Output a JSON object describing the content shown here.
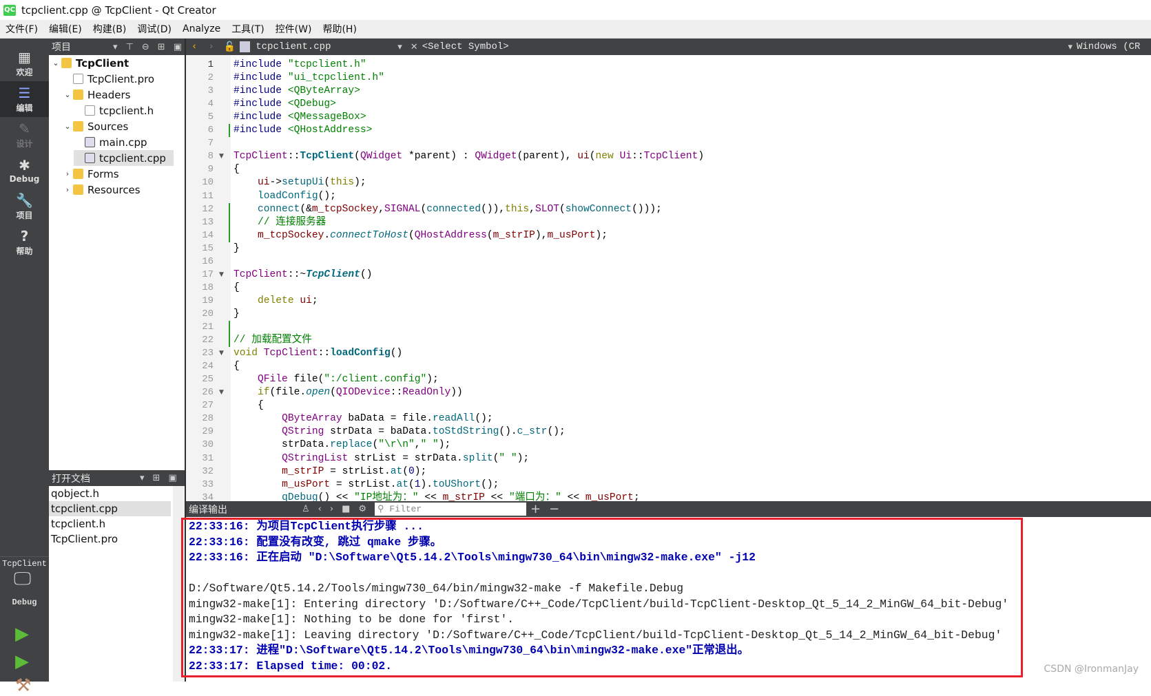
{
  "window": {
    "title": "tcpclient.cpp @ TcpClient - Qt Creator",
    "logo": "QC"
  },
  "menu": [
    "文件(F)",
    "编辑(E)",
    "构建(B)",
    "调试(D)",
    "Analyze",
    "工具(T)",
    "控件(W)",
    "帮助(H)"
  ],
  "modes": [
    {
      "label": "欢迎",
      "icon": "grid-icon"
    },
    {
      "label": "编辑",
      "icon": "edit-icon",
      "active": true
    },
    {
      "label": "设计",
      "icon": "pencil-icon",
      "disabled": true
    },
    {
      "label": "Debug",
      "icon": "bug-icon"
    },
    {
      "label": "项目",
      "icon": "wrench-icon"
    },
    {
      "label": "帮助",
      "icon": "help-icon"
    }
  ],
  "kit": {
    "project": "TcpClient",
    "config": "Debug"
  },
  "project_panel": {
    "title": "项目",
    "tree": [
      {
        "label": "TcpClient",
        "depth": 0,
        "chev": "down",
        "bold": true,
        "icon": "folder"
      },
      {
        "label": "TcpClient.pro",
        "depth": 1,
        "icon": "file"
      },
      {
        "label": "Headers",
        "depth": 1,
        "chev": "down",
        "icon": "folder"
      },
      {
        "label": "tcpclient.h",
        "depth": 2,
        "icon": "file"
      },
      {
        "label": "Sources",
        "depth": 1,
        "chev": "down",
        "icon": "folder"
      },
      {
        "label": "main.cpp",
        "depth": 2,
        "icon": "cppfile"
      },
      {
        "label": "tcpclient.cpp",
        "depth": 2,
        "icon": "cppfile",
        "selected": true
      },
      {
        "label": "Forms",
        "depth": 1,
        "chev": "right",
        "icon": "folder"
      },
      {
        "label": "Resources",
        "depth": 1,
        "chev": "right",
        "icon": "folder"
      }
    ]
  },
  "open_docs": {
    "title": "打开文档",
    "items": [
      "qobject.h",
      "tcpclient.cpp",
      "tcpclient.h",
      "TcpClient.pro"
    ],
    "selected": 1
  },
  "editor": {
    "file": "tcpclient.cpp",
    "symbol": "<Select Symbol>",
    "line_ending": "Windows (CR",
    "fold_lines": [
      8,
      17,
      23,
      26
    ],
    "changed_lines": [
      6,
      12,
      13,
      14,
      21,
      22
    ],
    "current_line": 1,
    "lines": [
      [
        [
          "#include",
          "pp"
        ],
        [
          " "
        ],
        [
          "\"tcpclient.h\"",
          "str"
        ]
      ],
      [
        [
          "#include",
          "pp"
        ],
        [
          " "
        ],
        [
          "\"ui_tcpclient.h\"",
          "str"
        ]
      ],
      [
        [
          "#include",
          "pp"
        ],
        [
          " "
        ],
        [
          "<QByteArray>",
          "str"
        ]
      ],
      [
        [
          "#include",
          "pp"
        ],
        [
          " "
        ],
        [
          "<QDebug>",
          "str"
        ]
      ],
      [
        [
          "#include",
          "pp"
        ],
        [
          " "
        ],
        [
          "<QMessageBox>",
          "str"
        ]
      ],
      [
        [
          "#include",
          "pp"
        ],
        [
          " "
        ],
        [
          "<QHostAddress>",
          "str"
        ]
      ],
      [],
      [
        [
          "TcpClient",
          "type"
        ],
        [
          "::"
        ],
        [
          "TcpClient",
          "fnb"
        ],
        [
          "("
        ],
        [
          "QWidget",
          "type"
        ],
        [
          " *parent) : "
        ],
        [
          "QWidget",
          "type"
        ],
        [
          "(parent), "
        ],
        [
          "ui",
          "mem"
        ],
        [
          "("
        ],
        [
          "new",
          "kw"
        ],
        [
          " "
        ],
        [
          "Ui",
          "type"
        ],
        [
          "::"
        ],
        [
          "TcpClient",
          "type"
        ],
        [
          ")"
        ]
      ],
      [
        [
          "{"
        ]
      ],
      [
        [
          "    "
        ],
        [
          "ui",
          "mem"
        ],
        [
          "->"
        ],
        [
          "setupUi",
          "fn"
        ],
        [
          "("
        ],
        [
          "this",
          "kw"
        ],
        [
          ");"
        ]
      ],
      [
        [
          "    "
        ],
        [
          "loadConfig",
          "fn"
        ],
        [
          "();"
        ]
      ],
      [
        [
          "    "
        ],
        [
          "connect",
          "fn"
        ],
        [
          "(&"
        ],
        [
          "m_tcpSockey",
          "mem"
        ],
        [
          ","
        ],
        [
          "SIGNAL",
          "type"
        ],
        [
          "("
        ],
        [
          "connected",
          "fn"
        ],
        [
          "()),"
        ],
        [
          "this",
          "kw"
        ],
        [
          ","
        ],
        [
          "SLOT",
          "type"
        ],
        [
          "("
        ],
        [
          "showConnect",
          "fn"
        ],
        [
          "()));"
        ]
      ],
      [
        [
          "    "
        ],
        [
          "// 连接服务器",
          "cm"
        ]
      ],
      [
        [
          "    "
        ],
        [
          "m_tcpSockey",
          "mem"
        ],
        [
          "."
        ],
        [
          "connectToHost",
          "it"
        ],
        [
          "("
        ],
        [
          "QHostAddress",
          "type"
        ],
        [
          "("
        ],
        [
          "m_strIP",
          "mem"
        ],
        [
          "),"
        ],
        [
          "m_usPort",
          "mem"
        ],
        [
          ");"
        ]
      ],
      [
        [
          "}"
        ]
      ],
      [],
      [
        [
          "TcpClient",
          "type"
        ],
        [
          "::~"
        ],
        [
          "TcpClient",
          "fnbi"
        ],
        [
          "()"
        ]
      ],
      [
        [
          "{"
        ]
      ],
      [
        [
          "    "
        ],
        [
          "delete",
          "kw"
        ],
        [
          " "
        ],
        [
          "ui",
          "mem"
        ],
        [
          ";"
        ]
      ],
      [
        [
          "}"
        ]
      ],
      [],
      [
        [
          "// 加载配置文件",
          "cm"
        ]
      ],
      [
        [
          "void",
          "kw"
        ],
        [
          " "
        ],
        [
          "TcpClient",
          "type"
        ],
        [
          "::"
        ],
        [
          "loadConfig",
          "fnb"
        ],
        [
          "()"
        ]
      ],
      [
        [
          "{"
        ]
      ],
      [
        [
          "    "
        ],
        [
          "QFile",
          "type"
        ],
        [
          " file("
        ],
        [
          "\":/client.config\"",
          "str"
        ],
        [
          ");"
        ]
      ],
      [
        [
          "    "
        ],
        [
          "if",
          "kw"
        ],
        [
          "(file."
        ],
        [
          "open",
          "it"
        ],
        [
          "("
        ],
        [
          "QIODevice",
          "type"
        ],
        [
          "::"
        ],
        [
          "ReadOnly",
          "type"
        ],
        [
          "))"
        ]
      ],
      [
        [
          "    {"
        ]
      ],
      [
        [
          "        "
        ],
        [
          "QByteArray",
          "type"
        ],
        [
          " baData = file."
        ],
        [
          "readAll",
          "fn"
        ],
        [
          "();"
        ]
      ],
      [
        [
          "        "
        ],
        [
          "QString",
          "type"
        ],
        [
          " strData = baData."
        ],
        [
          "toStdString",
          "fn"
        ],
        [
          "()."
        ],
        [
          "c_str",
          "fn"
        ],
        [
          "();"
        ]
      ],
      [
        [
          "        strData."
        ],
        [
          "replace",
          "fn"
        ],
        [
          "("
        ],
        [
          "\"\\r\\n\"",
          "str"
        ],
        [
          ","
        ],
        [
          "\" \"",
          "str"
        ],
        [
          ");"
        ]
      ],
      [
        [
          "        "
        ],
        [
          "QStringList",
          "type"
        ],
        [
          " strList = strData."
        ],
        [
          "split",
          "fn"
        ],
        [
          "("
        ],
        [
          "\" \"",
          "str"
        ],
        [
          ");"
        ]
      ],
      [
        [
          "        "
        ],
        [
          "m_strIP",
          "mem"
        ],
        [
          " = strList."
        ],
        [
          "at",
          "fn"
        ],
        [
          "("
        ],
        [
          "0",
          "num"
        ],
        [
          ");"
        ]
      ],
      [
        [
          "        "
        ],
        [
          "m_usPort",
          "mem"
        ],
        [
          " = strList."
        ],
        [
          "at",
          "fn"
        ],
        [
          "("
        ],
        [
          "1",
          "num"
        ],
        [
          ")."
        ],
        [
          "toUShort",
          "fn"
        ],
        [
          "();"
        ]
      ],
      [
        [
          "        "
        ],
        [
          "qDebug",
          "fn"
        ],
        [
          "() << "
        ],
        [
          "\"IP地址为：\"",
          "str"
        ],
        [
          " << "
        ],
        [
          "m_strIP",
          "mem"
        ],
        [
          " << "
        ],
        [
          "\"端口为：\"",
          "str"
        ],
        [
          " << "
        ],
        [
          "m_usPort",
          "mem"
        ],
        [
          ";"
        ]
      ]
    ]
  },
  "output": {
    "title": "编译输出",
    "filter_placeholder": "Filter",
    "lines": [
      {
        "t": "22:33:16: 为项目TcpClient执行步骤 ...",
        "bold": true
      },
      {
        "t": "22:33:16: 配置没有改变, 跳过 qmake 步骤。",
        "bold": true
      },
      {
        "t": "22:33:16: 正在启动 \"D:\\Software\\Qt5.14.2\\Tools\\mingw730_64\\bin\\mingw32-make.exe\" -j12",
        "bold": true
      },
      {
        "t": ""
      },
      {
        "t": "D:/Software/Qt5.14.2/Tools/mingw730_64/bin/mingw32-make -f Makefile.Debug"
      },
      {
        "t": "mingw32-make[1]: Entering directory 'D:/Software/C++_Code/TcpClient/build-TcpClient-Desktop_Qt_5_14_2_MinGW_64_bit-Debug'"
      },
      {
        "t": "mingw32-make[1]: Nothing to be done for 'first'."
      },
      {
        "t": "mingw32-make[1]: Leaving directory 'D:/Software/C++_Code/TcpClient/build-TcpClient-Desktop_Qt_5_14_2_MinGW_64_bit-Debug'"
      },
      {
        "t": "22:33:17: 进程\"D:\\Software\\Qt5.14.2\\Tools\\mingw730_64\\bin\\mingw32-make.exe\"正常退出。",
        "bold": true
      },
      {
        "t": "22:33:17: Elapsed time: 00:02.",
        "bold": true
      }
    ]
  },
  "watermark": "CSDN @IronmanJay",
  "colors": {
    "highlight_box": "#e8202a",
    "output_bold": "#0000b0",
    "sidebar": "#404244"
  }
}
